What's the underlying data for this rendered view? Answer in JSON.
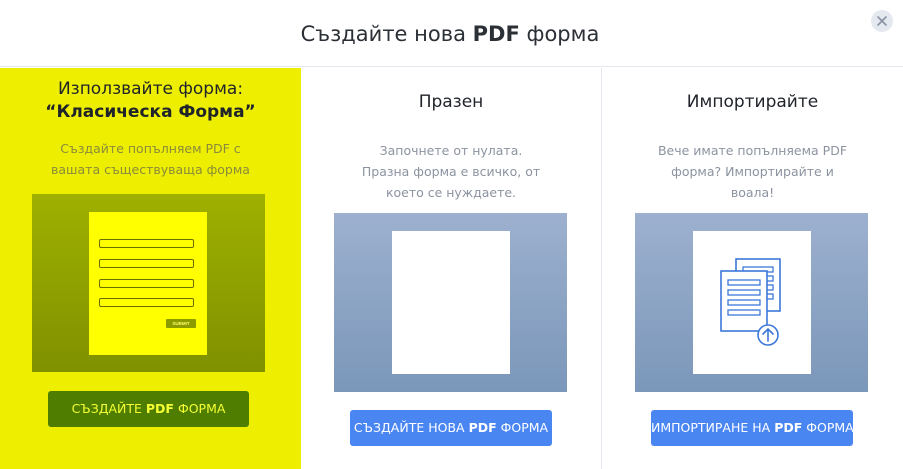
{
  "header": {
    "title_pre": "Създайте нова ",
    "title_bold": "PDF",
    "title_post": " форма"
  },
  "columns": [
    {
      "title_pre": "Използвайте форма: ",
      "title_bold": "“Класическа Форма”",
      "description": "Създайте попълняем PDF с вашата съществуваща форма",
      "preview_submit": "SUBMIT",
      "button_pre": "СЪЗДАЙТЕ ",
      "button_bold": "PDF",
      "button_post": " ФОРМА"
    },
    {
      "title": "Празен",
      "description": "Започнете от нулата. Празна форма е всичко, от което се нуждаете.",
      "button_pre": "СЪЗДАЙТЕ НОВА ",
      "button_bold": "PDF",
      "button_post": " ФОРМА"
    },
    {
      "title": "Импортирайте",
      "description": "Вече имате попълняема PDF форма? Импортирайте и воала!",
      "button_pre": "ИМПОРТИРАНЕ НА ",
      "button_bold": "PDF",
      "button_post": " ФОРМА"
    }
  ],
  "icons": {
    "close": "close-icon",
    "import": "document-upload-icon"
  },
  "colors": {
    "selected_column_bg": "#eeee00",
    "selected_button_bg": "#4e7d00",
    "selected_button_text": "#f5ff33",
    "primary_button_bg": "#4a86f2",
    "preview_gray": "#8ea4c4"
  }
}
